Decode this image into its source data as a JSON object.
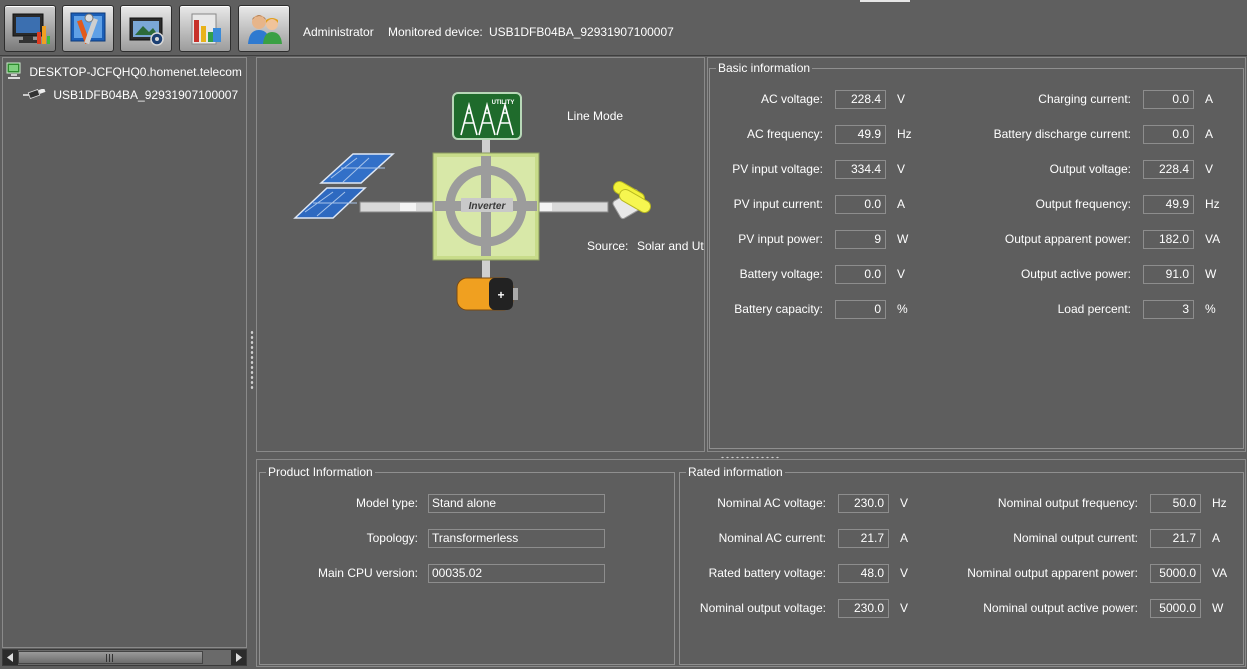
{
  "toolbar": {
    "buttons": [
      {
        "name": "monitor-icon",
        "active": true
      },
      {
        "name": "tools-icon",
        "active": false
      },
      {
        "name": "camera-icon",
        "active": false
      },
      {
        "name": "data-log-icon",
        "active": false
      },
      {
        "name": "users-icon",
        "active": false
      }
    ],
    "user": "Administrator",
    "monitored_label": "Monitored device:",
    "monitored_device": "USB1DFB04BA_92931907100007"
  },
  "tree": {
    "host": "DESKTOP-JCFQHQ0.homenet.telecom",
    "device": "USB1DFB04BA_92931907100007"
  },
  "diagram": {
    "utility_label": "UTILITY",
    "inverter_label": "Inverter",
    "mode": "Line Mode",
    "source_label": "Source:",
    "source_value": "Solar and Ut"
  },
  "basic_info": {
    "title": "Basic information",
    "left": [
      {
        "label": "AC voltage:",
        "value": "228.4",
        "unit": "V"
      },
      {
        "label": "AC frequency:",
        "value": "49.9",
        "unit": "Hz"
      },
      {
        "label": "PV input voltage:",
        "value": "334.4",
        "unit": "V"
      },
      {
        "label": "PV input current:",
        "value": "0.0",
        "unit": "A"
      },
      {
        "label": "PV input power:",
        "value": "9",
        "unit": "W"
      },
      {
        "label": "Battery voltage:",
        "value": "0.0",
        "unit": "V"
      },
      {
        "label": "Battery capacity:",
        "value": "0",
        "unit": "%"
      }
    ],
    "right": [
      {
        "label": "Charging current:",
        "value": "0.0",
        "unit": "A"
      },
      {
        "label": "Battery discharge current:",
        "value": "0.0",
        "unit": "A"
      },
      {
        "label": "Output voltage:",
        "value": "228.4",
        "unit": "V"
      },
      {
        "label": "Output frequency:",
        "value": "49.9",
        "unit": "Hz"
      },
      {
        "label": "Output apparent power:",
        "value": "182.0",
        "unit": "VA"
      },
      {
        "label": "Output active power:",
        "value": "91.0",
        "unit": "W"
      },
      {
        "label": "Load percent:",
        "value": "3",
        "unit": "%"
      }
    ]
  },
  "product_info": {
    "title": "Product Information",
    "rows": [
      {
        "label": "Model type:",
        "value": "Stand alone"
      },
      {
        "label": "Topology:",
        "value": "Transformerless"
      },
      {
        "label": "Main CPU version:",
        "value": "00035.02"
      }
    ]
  },
  "rated_info": {
    "title": "Rated information",
    "left": [
      {
        "label": "Nominal AC voltage:",
        "value": "230.0",
        "unit": "V"
      },
      {
        "label": "Nominal AC current:",
        "value": "21.7",
        "unit": "A"
      },
      {
        "label": "Rated battery voltage:",
        "value": "48.0",
        "unit": "V"
      },
      {
        "label": "Nominal output voltage:",
        "value": "230.0",
        "unit": "V"
      }
    ],
    "right": [
      {
        "label": "Nominal output frequency:",
        "value": "50.0",
        "unit": "Hz"
      },
      {
        "label": "Nominal output current:",
        "value": "21.7",
        "unit": "A"
      },
      {
        "label": "Nominal output apparent power:",
        "value": "5000.0",
        "unit": "VA"
      },
      {
        "label": "Nominal output active power:",
        "value": "5000.0",
        "unit": "W"
      }
    ]
  }
}
